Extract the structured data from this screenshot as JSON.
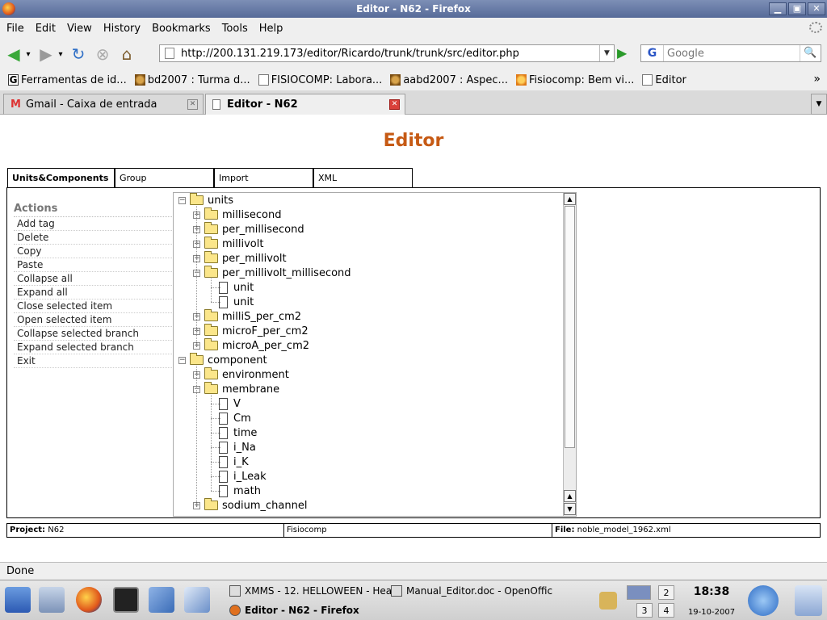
{
  "window": {
    "title": "Editor - N62 - Firefox"
  },
  "menu": [
    "File",
    "Edit",
    "View",
    "History",
    "Bookmarks",
    "Tools",
    "Help"
  ],
  "nav": {
    "url": "http://200.131.219.173/editor/Ricardo/trunk/trunk/src/editor.php",
    "search_placeholder": "Google",
    "search_engine_letter": "G"
  },
  "bookmarks": [
    {
      "label": "Ferramentas de id...",
      "icon": "google-icon"
    },
    {
      "label": "bd2007 : Turma d...",
      "icon": "people-icon"
    },
    {
      "label": "FISIOCOMP: Labora...",
      "icon": "page-icon"
    },
    {
      "label": "aabd2007 : Aspec...",
      "icon": "people-icon"
    },
    {
      "label": "Fisiocomp: Bem vi...",
      "icon": "star-icon"
    },
    {
      "label": "Editor",
      "icon": "page-icon"
    }
  ],
  "tabs": [
    {
      "label": "Gmail - Caixa de entrada",
      "icon": "gmail-icon"
    },
    {
      "label": "Editor - N62",
      "icon": "page-icon"
    }
  ],
  "page": {
    "title": "Editor",
    "tabs": [
      "Units&Components",
      "Group",
      "Import",
      "XML"
    ],
    "actions_header": "Actions",
    "actions": [
      "Add tag",
      "Delete",
      "Copy",
      "Paste",
      "Collapse all",
      "Expand all",
      "Close selected item",
      "Open selected item",
      "Collapse selected branch",
      "Expand selected branch",
      "Exit"
    ],
    "tree": [
      {
        "label": "units",
        "level": 0,
        "type": "folder",
        "open": true
      },
      {
        "label": "millisecond",
        "level": 1,
        "type": "folder",
        "open": false
      },
      {
        "label": "per_millisecond",
        "level": 1,
        "type": "folder",
        "open": false
      },
      {
        "label": "millivolt",
        "level": 1,
        "type": "folder",
        "open": false
      },
      {
        "label": "per_millivolt",
        "level": 1,
        "type": "folder",
        "open": false
      },
      {
        "label": "per_millivolt_millisecond",
        "level": 1,
        "type": "folder",
        "open": true
      },
      {
        "label": "unit",
        "level": 2,
        "type": "file"
      },
      {
        "label": "unit",
        "level": 2,
        "type": "file"
      },
      {
        "label": "milliS_per_cm2",
        "level": 1,
        "type": "folder",
        "open": false
      },
      {
        "label": "microF_per_cm2",
        "level": 1,
        "type": "folder",
        "open": false
      },
      {
        "label": "microA_per_cm2",
        "level": 1,
        "type": "folder",
        "open": false
      },
      {
        "label": "component",
        "level": 0,
        "type": "folder",
        "open": true
      },
      {
        "label": "environment",
        "level": 1,
        "type": "folder",
        "open": false
      },
      {
        "label": "membrane",
        "level": 1,
        "type": "folder",
        "open": true
      },
      {
        "label": "V",
        "level": 2,
        "type": "file"
      },
      {
        "label": "Cm",
        "level": 2,
        "type": "file"
      },
      {
        "label": "time",
        "level": 2,
        "type": "file"
      },
      {
        "label": "i_Na",
        "level": 2,
        "type": "file"
      },
      {
        "label": "i_K",
        "level": 2,
        "type": "file"
      },
      {
        "label": "i_Leak",
        "level": 2,
        "type": "file"
      },
      {
        "label": "math",
        "level": 2,
        "type": "file"
      },
      {
        "label": "sodium_channel",
        "level": 1,
        "type": "folder",
        "open": false
      }
    ],
    "status": {
      "project_label": "Project:",
      "project_value": "N62",
      "group": "Fisiocomp",
      "file_label": "File:",
      "file_value": "noble_model_1962.xml"
    }
  },
  "statusbar": "Done",
  "taskbar": {
    "tasks": [
      "XMMS - 12. HELLOWEEN - Heav",
      "Manual_Editor.doc - OpenOffic",
      "Editor - N62 - Firefox"
    ],
    "desktops": [
      "2",
      "3",
      "4"
    ],
    "clock": "18:38",
    "date": "19-10-2007"
  }
}
